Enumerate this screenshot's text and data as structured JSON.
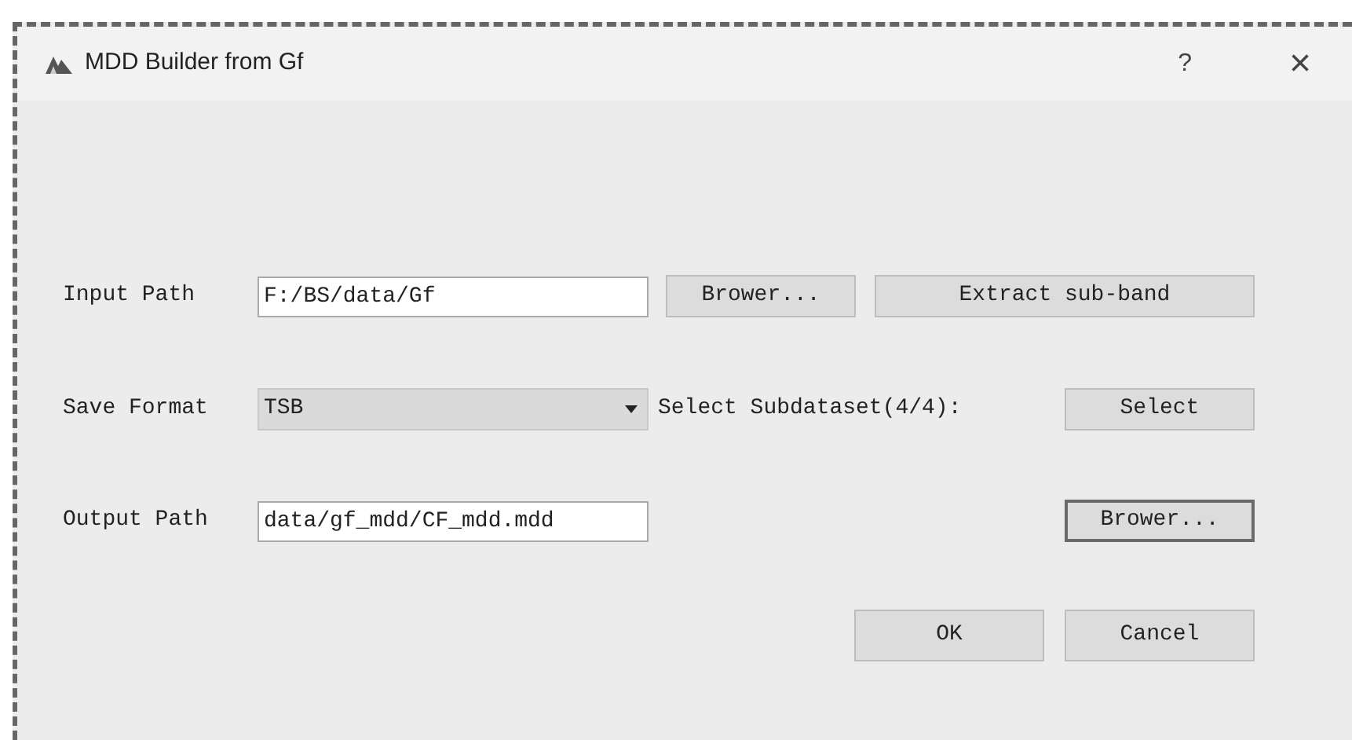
{
  "window": {
    "title": "MDD Builder from Gf",
    "help": "?",
    "close": "×"
  },
  "rows": [
    {
      "label": "Input Path",
      "field": {
        "kind": "text",
        "value": "F:/BS/data/Gf"
      },
      "buttons": [
        {
          "label": "Brower...",
          "focused": false
        },
        {
          "label": "Extract sub-band",
          "focused": false
        }
      ]
    },
    {
      "label": "Save Format",
      "field": {
        "kind": "combo",
        "value": "TSB"
      },
      "note": "Select Subdataset(4/4):",
      "buttons": [
        {
          "label": "Select",
          "focused": false
        }
      ]
    },
    {
      "label": "Output Path",
      "field": {
        "kind": "text",
        "value": "data/gf_mdd/CF_mdd.mdd"
      },
      "buttons": [
        {
          "label": "Brower...",
          "focused": true
        }
      ]
    }
  ],
  "footer_buttons": [
    {
      "label": "OK",
      "focused": false
    },
    {
      "label": "Cancel",
      "focused": false
    }
  ]
}
